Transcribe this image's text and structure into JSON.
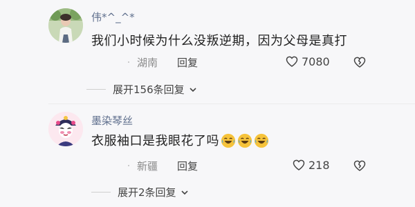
{
  "comments": [
    {
      "username": "伟*^_^*",
      "content": "我们小时候为什么没叛逆期，因为父母是真打",
      "emoji_count": 0,
      "location": "湖南",
      "reply_label": "回复",
      "likes": "7080",
      "expand_label": "展开156条回复",
      "avatar_icon": "person-photo"
    },
    {
      "username": "墨染琴丝",
      "content": "衣服袖口是我眼花了吗",
      "emoji_count": 3,
      "emoji_icon": "laughing-crying-emoji",
      "location": "新疆",
      "reply_label": "回复",
      "likes": "218",
      "expand_label": "展开2条回复",
      "avatar_icon": "opera-character"
    }
  ],
  "colors": {
    "username": "#5f6f8d",
    "text": "#222222",
    "meta": "#8a8a8a",
    "background": "#f7f7f9"
  }
}
